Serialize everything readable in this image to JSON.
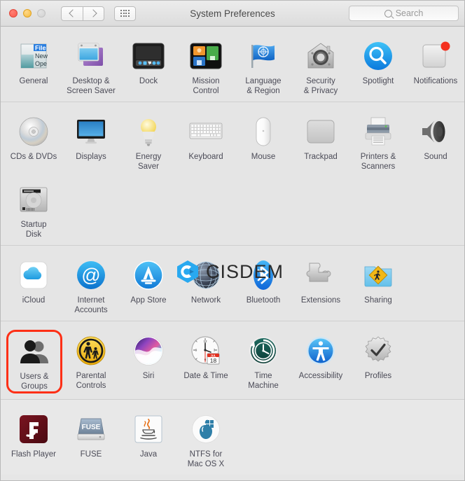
{
  "window": {
    "title": "System Preferences",
    "traffic_lights": [
      "close",
      "minimize",
      "zoom"
    ],
    "nav_back_label": "Back",
    "nav_forward_label": "Forward",
    "show_all_label": "Show All"
  },
  "search": {
    "placeholder": "Search",
    "value": ""
  },
  "watermark": {
    "text": "CISDEM"
  },
  "highlight": {
    "color": "#fd2f16",
    "target": "Users & Groups"
  },
  "sections": [
    {
      "id": "personal",
      "panes": [
        {
          "label": "General",
          "icon": "general-icon"
        },
        {
          "label": "Desktop &\nScreen Saver",
          "icon": "desktop-screensaver-icon"
        },
        {
          "label": "Dock",
          "icon": "dock-icon"
        },
        {
          "label": "Mission\nControl",
          "icon": "mission-control-icon"
        },
        {
          "label": "Language\n& Region",
          "icon": "language-region-icon"
        },
        {
          "label": "Security\n& Privacy",
          "icon": "security-privacy-icon"
        },
        {
          "label": "Spotlight",
          "icon": "spotlight-icon"
        },
        {
          "label": "Notifications",
          "icon": "notifications-icon"
        }
      ]
    },
    {
      "id": "hardware",
      "panes": [
        {
          "label": "CDs & DVDs",
          "icon": "cds-dvds-icon"
        },
        {
          "label": "Displays",
          "icon": "displays-icon"
        },
        {
          "label": "Energy\nSaver",
          "icon": "energy-saver-icon"
        },
        {
          "label": "Keyboard",
          "icon": "keyboard-icon"
        },
        {
          "label": "Mouse",
          "icon": "mouse-icon"
        },
        {
          "label": "Trackpad",
          "icon": "trackpad-icon"
        },
        {
          "label": "Printers &\nScanners",
          "icon": "printers-scanners-icon"
        },
        {
          "label": "Sound",
          "icon": "sound-icon"
        },
        {
          "label": "Startup\nDisk",
          "icon": "startup-disk-icon"
        }
      ]
    },
    {
      "id": "internet",
      "panes": [
        {
          "label": "iCloud",
          "icon": "icloud-icon"
        },
        {
          "label": "Internet\nAccounts",
          "icon": "internet-accounts-icon"
        },
        {
          "label": "App Store",
          "icon": "app-store-icon"
        },
        {
          "label": "Network",
          "icon": "network-icon"
        },
        {
          "label": "Bluetooth",
          "icon": "bluetooth-icon"
        },
        {
          "label": "Extensions",
          "icon": "extensions-icon"
        },
        {
          "label": "Sharing",
          "icon": "sharing-icon"
        }
      ]
    },
    {
      "id": "system",
      "panes": [
        {
          "label": "Users &\nGroups",
          "icon": "users-groups-icon",
          "highlighted": true
        },
        {
          "label": "Parental\nControls",
          "icon": "parental-controls-icon"
        },
        {
          "label": "Siri",
          "icon": "siri-icon"
        },
        {
          "label": "Date & Time",
          "icon": "date-time-icon"
        },
        {
          "label": "Time\nMachine",
          "icon": "time-machine-icon"
        },
        {
          "label": "Accessibility",
          "icon": "accessibility-icon"
        },
        {
          "label": "Profiles",
          "icon": "profiles-icon"
        }
      ]
    },
    {
      "id": "other",
      "panes": [
        {
          "label": "Flash Player",
          "icon": "flash-player-icon"
        },
        {
          "label": "FUSE",
          "icon": "fuse-icon"
        },
        {
          "label": "Java",
          "icon": "java-icon"
        },
        {
          "label": "NTFS for\nMac OS X",
          "icon": "ntfs-mac-icon"
        }
      ]
    }
  ],
  "icon_glyphs": {
    "date_time_month": "JUL",
    "date_time_day": "18",
    "fuse_label": "FUSE",
    "general_menu": [
      "File",
      "New",
      "Open"
    ]
  }
}
